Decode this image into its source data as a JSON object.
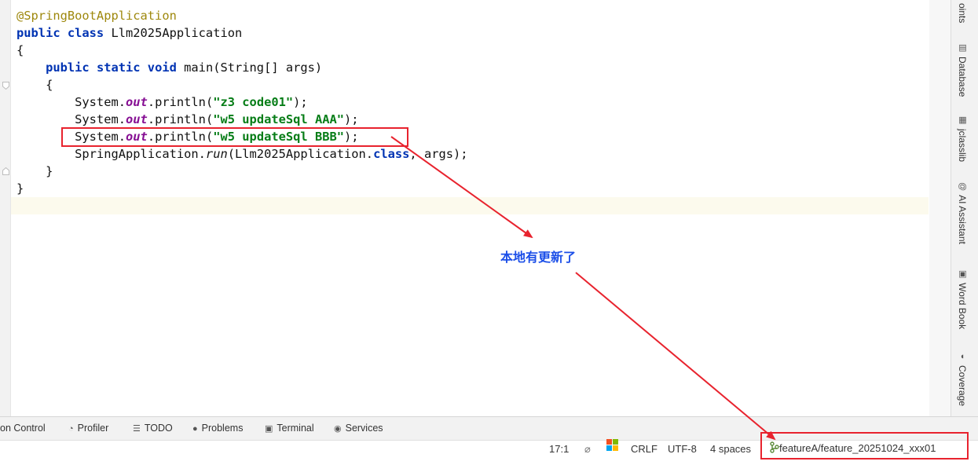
{
  "editor": {
    "lines": [
      {
        "id": "l1",
        "segments": [
          {
            "t": "@SpringBootApplication",
            "c": "ann"
          }
        ]
      },
      {
        "id": "l2",
        "segments": [
          {
            "t": "public class",
            "c": "kw"
          },
          {
            "t": " Llm2025Application",
            "c": ""
          }
        ]
      },
      {
        "id": "l3",
        "segments": [
          {
            "t": "{",
            "c": ""
          }
        ]
      },
      {
        "id": "l4",
        "segments": [
          {
            "t": "    ",
            "c": ""
          },
          {
            "t": "public static void",
            "c": "kw"
          },
          {
            "t": " main(String[] args)",
            "c": ""
          }
        ]
      },
      {
        "id": "l5",
        "segments": [
          {
            "t": "    {",
            "c": ""
          }
        ]
      },
      {
        "id": "l6",
        "segments": [
          {
            "t": "        System.",
            "c": ""
          },
          {
            "t": "out",
            "c": "fld"
          },
          {
            "t": ".println(",
            "c": ""
          },
          {
            "t": "\"z3 code01\"",
            "c": "str"
          },
          {
            "t": ");",
            "c": ""
          }
        ]
      },
      {
        "id": "l7",
        "segments": [
          {
            "t": "        System.",
            "c": ""
          },
          {
            "t": "out",
            "c": "fld"
          },
          {
            "t": ".println(",
            "c": ""
          },
          {
            "t": "\"w5 updateSql AAA\"",
            "c": "str"
          },
          {
            "t": ");",
            "c": ""
          }
        ]
      },
      {
        "id": "l8",
        "segments": [
          {
            "t": "        System.",
            "c": ""
          },
          {
            "t": "out",
            "c": "fld"
          },
          {
            "t": ".println(",
            "c": ""
          },
          {
            "t": "\"w5 updateSql BBB\"",
            "c": "str"
          },
          {
            "t": ");",
            "c": ""
          }
        ]
      },
      {
        "id": "l9",
        "segments": [
          {
            "t": "        SpringApplication.",
            "c": ""
          },
          {
            "t": "run",
            "c": "it"
          },
          {
            "t": "(Llm2025Application.",
            "c": ""
          },
          {
            "t": "class",
            "c": "kw"
          },
          {
            "t": ", args);",
            "c": ""
          }
        ]
      },
      {
        "id": "l10",
        "segments": [
          {
            "t": "    }",
            "c": ""
          }
        ]
      },
      {
        "id": "l11",
        "segments": [
          {
            "t": "}",
            "c": ""
          }
        ]
      }
    ]
  },
  "right_toolbar": {
    "items": [
      {
        "label": "oints",
        "icon": ""
      },
      {
        "label": "Database",
        "icon": "▤"
      },
      {
        "label": "jclasslib",
        "icon": "▦"
      },
      {
        "label": "AI Assistant",
        "icon": "@"
      },
      {
        "label": "Word Book",
        "icon": "▣"
      },
      {
        "label": "Coverage",
        "icon": "◖"
      }
    ]
  },
  "tool_tabs": {
    "items": [
      {
        "label": "on Control",
        "icon": ""
      },
      {
        "label": "Profiler",
        "icon": "◔"
      },
      {
        "label": "TODO",
        "icon": "☰"
      },
      {
        "label": "Problems",
        "icon": "●"
      },
      {
        "label": "Terminal",
        "icon": "▣"
      },
      {
        "label": "Services",
        "icon": "◉"
      }
    ]
  },
  "status_bar": {
    "position": "17:1",
    "no_inspection_icon": "⌀",
    "line_separator": "CRLF",
    "encoding": "UTF-8",
    "indent": "4 spaces",
    "branch": "featureA/feature_20251024_xxx01",
    "branch_icon": "git-branch-icon"
  },
  "annotation": {
    "note": "本地有更新了",
    "color": "#e8232e",
    "note_color": "#1c4fe8"
  }
}
